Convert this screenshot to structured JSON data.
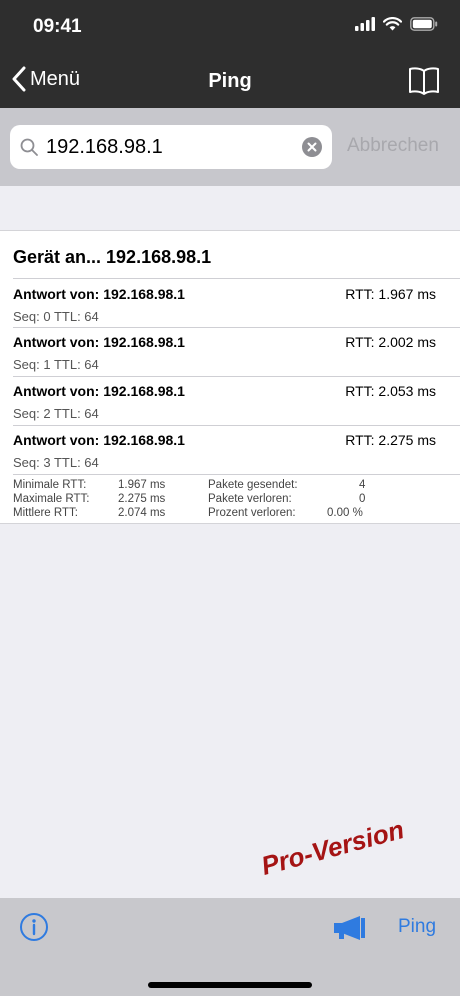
{
  "status": {
    "time": "09:41"
  },
  "nav": {
    "back_label": "Menü",
    "title": "Ping"
  },
  "search": {
    "value": "192.168.98.1",
    "cancel_label": "Abbrechen"
  },
  "results": {
    "device_title": "Gerät an... 192.168.98.1",
    "entries": [
      {
        "from": "Antwort von: 192.168.98.1",
        "rtt": "RTT: 1.967 ms",
        "seq": "Seq: 0  TTL: 64"
      },
      {
        "from": "Antwort von: 192.168.98.1",
        "rtt": "RTT: 2.002 ms",
        "seq": "Seq: 1  TTL: 64"
      },
      {
        "from": "Antwort von: 192.168.98.1",
        "rtt": "RTT: 2.053 ms",
        "seq": "Seq: 2  TTL: 64"
      },
      {
        "from": "Antwort von: 192.168.98.1",
        "rtt": "RTT: 2.275 ms",
        "seq": "Seq: 3  TTL: 64"
      }
    ],
    "stats": {
      "min_label": "Minimale RTT:",
      "min_value": "1.967 ms",
      "max_label": "Maximale RTT:",
      "max_value": "2.275 ms",
      "avg_label": "Mittlere RTT:",
      "avg_value": "2.074 ms",
      "sent_label": "Pakete gesendet:",
      "sent_value": "4",
      "lost_label": "Pakete verloren:",
      "lost_value": "0",
      "pct_label": "Prozent verloren:",
      "pct_value": "0.00 %"
    }
  },
  "toolbar": {
    "ping_label": "Ping"
  },
  "watermark": "Pro-Version",
  "colors": {
    "accent": "#2f7be0",
    "topbar": "#2e2e2e",
    "watermark": "#a51414"
  }
}
